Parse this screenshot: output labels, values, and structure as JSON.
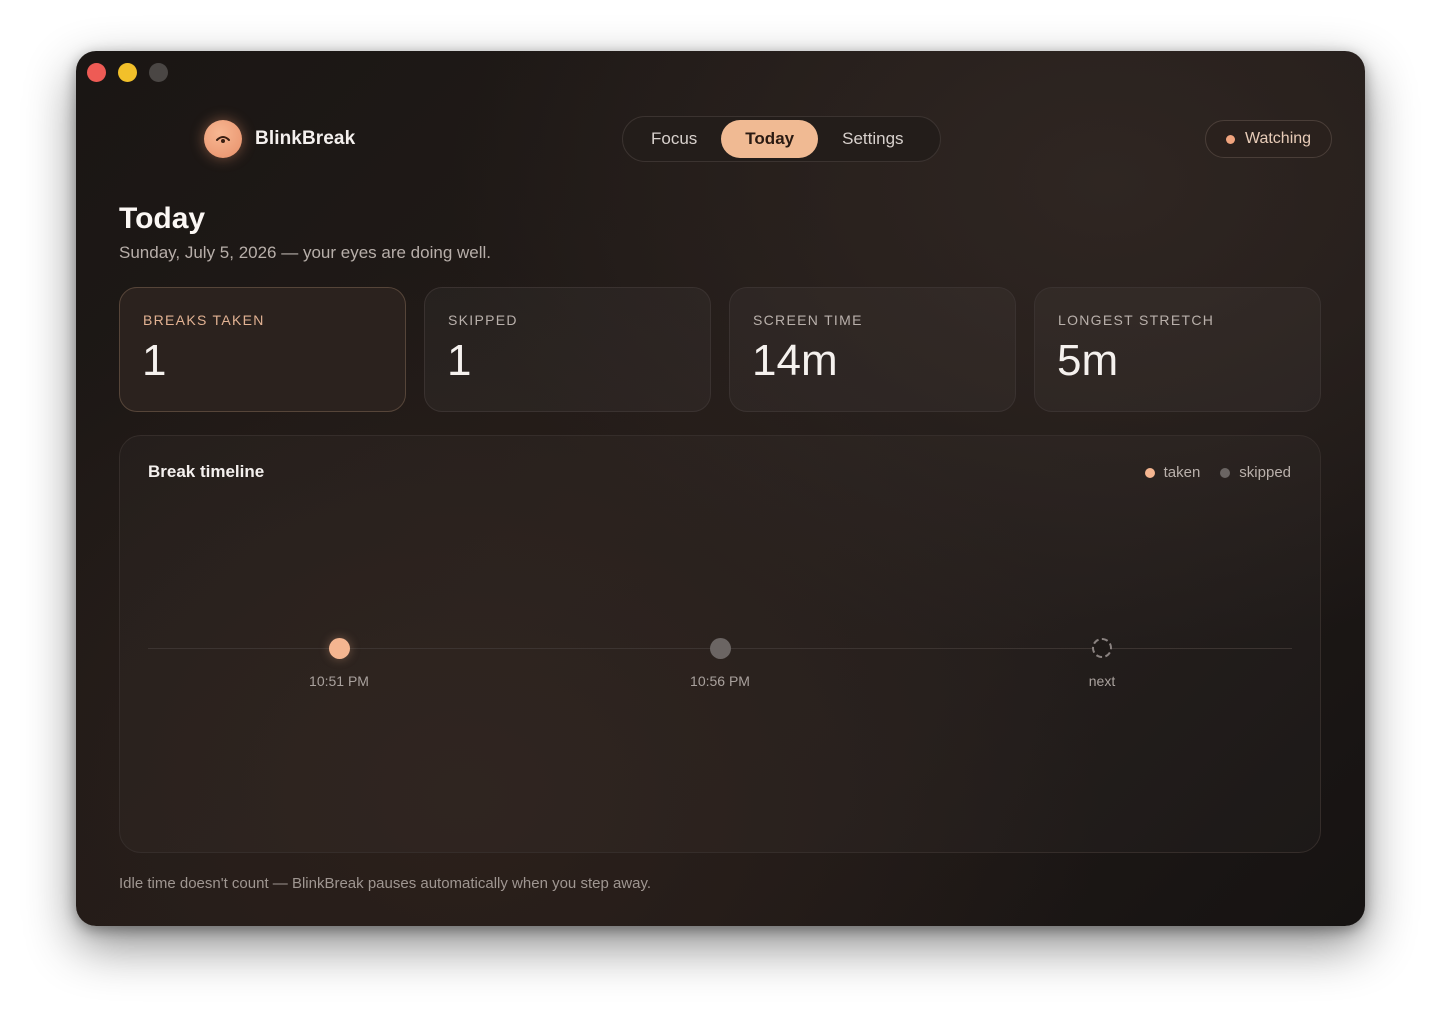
{
  "app": {
    "name": "BlinkBreak"
  },
  "nav": {
    "tabs": [
      {
        "label": "Focus",
        "active": false
      },
      {
        "label": "Today",
        "active": true
      },
      {
        "label": "Settings",
        "active": false
      }
    ]
  },
  "status": {
    "label": "Watching",
    "color": "#f0a47e"
  },
  "page": {
    "title": "Today",
    "subtitle": "Sunday, July 5, 2026 — your eyes are doing well."
  },
  "stats": [
    {
      "label": "BREAKS TAKEN",
      "value": "1",
      "highlight": true
    },
    {
      "label": "SKIPPED",
      "value": "1",
      "highlight": false
    },
    {
      "label": "SCREEN TIME",
      "value": "14m",
      "highlight": false
    },
    {
      "label": "LONGEST STRETCH",
      "value": "5m",
      "highlight": false
    }
  ],
  "timeline": {
    "title": "Break timeline",
    "legend": [
      {
        "label": "taken",
        "color": "#f4b590"
      },
      {
        "label": "skipped",
        "color": "#6b6563"
      }
    ],
    "events": [
      {
        "kind": "taken",
        "label": "10:51 PM"
      },
      {
        "kind": "skipped",
        "label": "10:56 PM"
      },
      {
        "kind": "next",
        "label": "next"
      }
    ]
  },
  "footer": "Idle time doesn't count — BlinkBreak pauses automatically when you step away.",
  "colors": {
    "accent": "#f0ba93",
    "window_close": "#ee5b55",
    "window_minimize": "#f2c02a"
  }
}
